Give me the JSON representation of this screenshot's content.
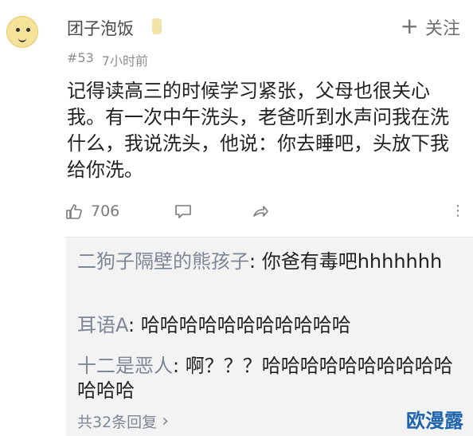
{
  "header": {
    "username": "团子泡饭",
    "badge": "",
    "follow_label": "关注",
    "follow_icon": "plus-icon"
  },
  "meta": {
    "floor": "#53",
    "time": "7小时前"
  },
  "comment": {
    "text": "记得读高三的时候学习紧张，父母也很关心我。有一次中午洗头，老爸听到水声问我在洗什么，我说洗头，他说：你去睡吧，头放下我给你洗。"
  },
  "actions": {
    "like_count": "706",
    "like_icon": "thumbs-up-icon",
    "comment_icon": "comment-icon",
    "share_icon": "share-icon",
    "more_icon": "more-vertical-icon"
  },
  "replies": [
    {
      "name": "二狗子隔壁的熊孩子",
      "text": "你爸有毒吧hhhhhhh"
    },
    {
      "name": "耳语A",
      "text": "哈哈哈哈哈哈哈哈哈哈哈"
    },
    {
      "name": "十二是恶人",
      "text": "啊？？？哈哈哈哈哈哈哈哈哈哈哈哈哈"
    }
  ],
  "reply_count": {
    "label": "共32条回复",
    "icon": "chevron-right-icon"
  },
  "watermark": {
    "text": "欧漫露"
  },
  "colors": {
    "reply_background": "#f3f3f3",
    "reply_name": "#7c8796",
    "watermark": "#1d63ad"
  }
}
